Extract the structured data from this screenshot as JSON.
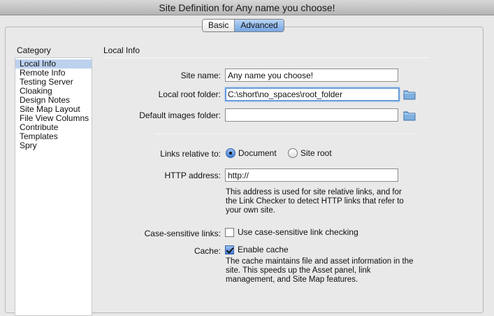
{
  "window": {
    "title": "Site Definition for Any name you choose!"
  },
  "tabs": [
    {
      "label": "Basic",
      "active": false
    },
    {
      "label": "Advanced",
      "active": true
    }
  ],
  "category": {
    "header": "Category",
    "items": [
      {
        "label": "Local Info",
        "selected": true
      },
      {
        "label": "Remote Info",
        "selected": false
      },
      {
        "label": "Testing Server",
        "selected": false
      },
      {
        "label": "Cloaking",
        "selected": false
      },
      {
        "label": "Design Notes",
        "selected": false
      },
      {
        "label": "Site Map Layout",
        "selected": false
      },
      {
        "label": "File View Columns",
        "selected": false
      },
      {
        "label": "Contribute",
        "selected": false
      },
      {
        "label": "Templates",
        "selected": false
      },
      {
        "label": "Spry",
        "selected": false
      }
    ]
  },
  "local_info": {
    "title": "Local Info",
    "site_name": {
      "label": "Site name:",
      "value": "Any name you choose!"
    },
    "local_root": {
      "label": "Local root folder:",
      "value": "C:\\short\\no_spaces\\root_folder"
    },
    "default_images": {
      "label": "Default images folder:",
      "value": ""
    },
    "links_relative": {
      "label": "Links relative to:",
      "options": [
        {
          "label": "Document",
          "selected": true
        },
        {
          "label": "Site root",
          "selected": false
        }
      ]
    },
    "http_address": {
      "label": "HTTP address:",
      "value": "http://",
      "help": "This address is used for site relative links, and for the Link Checker to detect HTTP links that refer to your own site."
    },
    "case_sensitive": {
      "label": "Case-sensitive links:",
      "checkbox_label": "Use case-sensitive link checking",
      "checked": false
    },
    "cache": {
      "label": "Cache:",
      "checkbox_label": "Enable cache",
      "checked": true,
      "help": "The cache maintains file and asset information in the site.  This speeds up the Asset panel, link management, and Site Map features."
    }
  },
  "icons": {
    "folder": "folder-icon"
  },
  "colors": {
    "selection": "#bcd1ee",
    "active_tab": "#75a6e4",
    "folder": "#7fb1e0"
  }
}
